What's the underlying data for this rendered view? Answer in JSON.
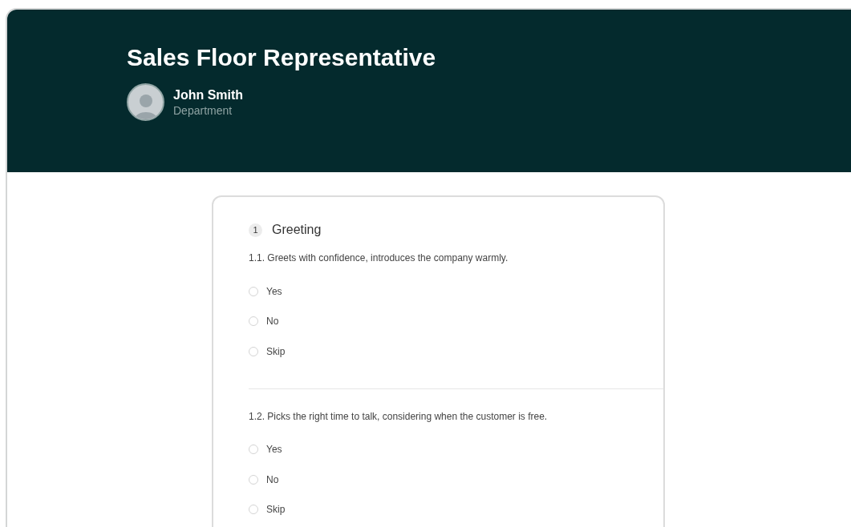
{
  "header": {
    "title": "Sales Floor Representative",
    "user": {
      "name": "John Smith",
      "department": "Department"
    }
  },
  "sections": [
    {
      "number": "1",
      "title": "Greeting",
      "questions": [
        {
          "text": "1.1. Greets with confidence, introduces the company warmly.",
          "options": [
            {
              "label": "Yes",
              "selected": false
            },
            {
              "label": "No",
              "selected": false
            },
            {
              "label": "Skip",
              "selected": false
            }
          ]
        },
        {
          "text": "1.2. Picks the right time to talk, considering when the customer is free.",
          "options": [
            {
              "label": "Yes",
              "selected": false
            },
            {
              "label": "No",
              "selected": false
            },
            {
              "label": "Skip",
              "selected": false
            }
          ]
        }
      ]
    }
  ]
}
